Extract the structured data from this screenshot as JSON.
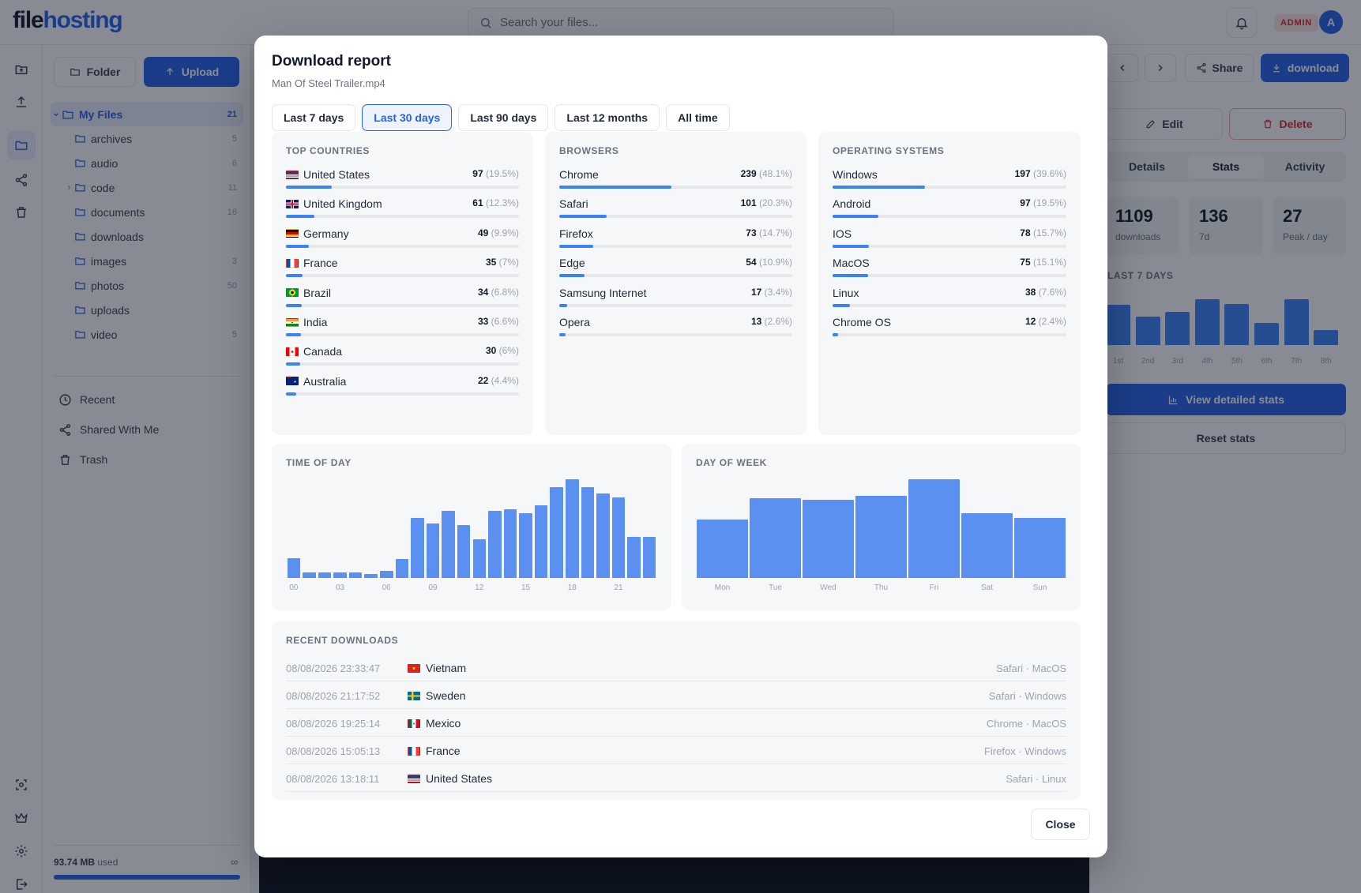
{
  "app": {
    "logo_part1": "file",
    "logo_part2": "hosting",
    "search_placeholder": "Search your files...",
    "admin_badge": "ADMIN",
    "avatar_initial": "A",
    "accent_color": "#2563eb"
  },
  "sidebar": {
    "folder_button": "Folder",
    "upload_button": "Upload",
    "root": {
      "label": "My Files",
      "count": "21"
    },
    "folders": [
      {
        "label": "archives",
        "count": "5",
        "expandable": false
      },
      {
        "label": "audio",
        "count": "6",
        "expandable": false
      },
      {
        "label": "code",
        "count": "11",
        "expandable": true
      },
      {
        "label": "documents",
        "count": "16",
        "expandable": false
      },
      {
        "label": "downloads",
        "count": "",
        "expandable": false
      },
      {
        "label": "images",
        "count": "3",
        "expandable": false
      },
      {
        "label": "photos",
        "count": "50",
        "expandable": false
      },
      {
        "label": "uploads",
        "count": "",
        "expandable": false
      },
      {
        "label": "video",
        "count": "5",
        "expandable": false
      }
    ],
    "links": [
      {
        "label": "Recent",
        "icon": "clock-icon"
      },
      {
        "label": "Shared With Me",
        "icon": "share-icon"
      },
      {
        "label": "Trash",
        "icon": "trash-icon"
      }
    ],
    "storage_used": "93.74 MB",
    "storage_suffix": "used",
    "storage_limit": "∞",
    "storage_fraction": 1.0
  },
  "right_panel": {
    "share": "Share",
    "download": "download",
    "edit": "Edit",
    "delete": "Delete",
    "tabs": [
      "Details",
      "Stats",
      "Activity"
    ],
    "active_tab": "Stats",
    "stats": [
      {
        "value": "1109",
        "label": "downloads"
      },
      {
        "value": "136",
        "label": "7d"
      },
      {
        "value": "27",
        "label": "Peak / day"
      }
    ],
    "last7_title": "LAST 7 DAYS",
    "last7": [
      {
        "label": "1st",
        "value": 68
      },
      {
        "label": "2nd",
        "value": 48
      },
      {
        "label": "3rd",
        "value": 56
      },
      {
        "label": "4th",
        "value": 78
      },
      {
        "label": "5th",
        "value": 70
      },
      {
        "label": "6th",
        "value": 38
      },
      {
        "label": "7th",
        "value": 78
      },
      {
        "label": "8th",
        "value": 26
      }
    ],
    "view_detailed": "View detailed stats",
    "reset": "Reset stats"
  },
  "modal": {
    "title": "Download report",
    "subtitle": "Man Of Steel Trailer.mp4",
    "ranges": [
      "Last 7 days",
      "Last 30 days",
      "Last 90 days",
      "Last 12 months",
      "All time"
    ],
    "active_range": "Last 30 days",
    "countries_title": "TOP COUNTRIES",
    "countries": [
      {
        "name": "United States",
        "value": "97",
        "pct": "(19.5%)",
        "frac": 0.195,
        "flag": "us"
      },
      {
        "name": "United Kingdom",
        "value": "61",
        "pct": "(12.3%)",
        "frac": 0.123,
        "flag": "gb"
      },
      {
        "name": "Germany",
        "value": "49",
        "pct": "(9.9%)",
        "frac": 0.099,
        "flag": "de"
      },
      {
        "name": "France",
        "value": "35",
        "pct": "(7%)",
        "frac": 0.07,
        "flag": "fr"
      },
      {
        "name": "Brazil",
        "value": "34",
        "pct": "(6.8%)",
        "frac": 0.068,
        "flag": "br"
      },
      {
        "name": "India",
        "value": "33",
        "pct": "(6.6%)",
        "frac": 0.066,
        "flag": "in"
      },
      {
        "name": "Canada",
        "value": "30",
        "pct": "(6%)",
        "frac": 0.06,
        "flag": "ca"
      },
      {
        "name": "Australia",
        "value": "22",
        "pct": "(4.4%)",
        "frac": 0.044,
        "flag": "au"
      }
    ],
    "browsers_title": "BROWSERS",
    "browsers": [
      {
        "name": "Chrome",
        "value": "239",
        "pct": "(48.1%)",
        "frac": 0.481
      },
      {
        "name": "Safari",
        "value": "101",
        "pct": "(20.3%)",
        "frac": 0.203
      },
      {
        "name": "Firefox",
        "value": "73",
        "pct": "(14.7%)",
        "frac": 0.147
      },
      {
        "name": "Edge",
        "value": "54",
        "pct": "(10.9%)",
        "frac": 0.109
      },
      {
        "name": "Samsung Internet",
        "value": "17",
        "pct": "(3.4%)",
        "frac": 0.034
      },
      {
        "name": "Opera",
        "value": "13",
        "pct": "(2.6%)",
        "frac": 0.026
      }
    ],
    "os_title": "OPERATING SYSTEMS",
    "os": [
      {
        "name": "Windows",
        "value": "197",
        "pct": "(39.6%)",
        "frac": 0.396
      },
      {
        "name": "Android",
        "value": "97",
        "pct": "(19.5%)",
        "frac": 0.195
      },
      {
        "name": "IOS",
        "value": "78",
        "pct": "(15.7%)",
        "frac": 0.157
      },
      {
        "name": "MacOS",
        "value": "75",
        "pct": "(15.1%)",
        "frac": 0.151
      },
      {
        "name": "Linux",
        "value": "38",
        "pct": "(7.6%)",
        "frac": 0.076
      },
      {
        "name": "Chrome OS",
        "value": "12",
        "pct": "(2.4%)",
        "frac": 0.024
      }
    ],
    "recent_title": "RECENT DOWNLOADS",
    "recent": [
      {
        "time": "08/08/2026 23:33:47",
        "country": "Vietnam",
        "flag": "vn",
        "ua": "Safari · MacOS"
      },
      {
        "time": "08/08/2026 21:17:52",
        "country": "Sweden",
        "flag": "se",
        "ua": "Safari · Windows"
      },
      {
        "time": "08/08/2026 19:25:14",
        "country": "Mexico",
        "flag": "mx",
        "ua": "Chrome · MacOS"
      },
      {
        "time": "08/08/2026 15:05:13",
        "country": "France",
        "flag": "fr",
        "ua": "Firefox · Windows"
      },
      {
        "time": "08/08/2026 13:18:11",
        "country": "United States",
        "flag": "us",
        "ua": "Safari · Linux"
      }
    ],
    "close": "Close"
  },
  "chart_data": [
    {
      "type": "bar",
      "title": "TIME OF DAY",
      "categories": [
        "00",
        "01",
        "02",
        "03",
        "04",
        "05",
        "06",
        "07",
        "08",
        "09",
        "10",
        "11",
        "12",
        "13",
        "14",
        "15",
        "16",
        "17",
        "18",
        "19",
        "20",
        "21",
        "22",
        "23"
      ],
      "tick_labels": [
        "00",
        "03",
        "06",
        "09",
        "12",
        "15",
        "18",
        "21"
      ],
      "values": [
        20,
        6,
        6,
        6,
        6,
        4,
        7,
        19,
        61,
        55,
        68,
        54,
        39,
        68,
        70,
        66,
        74,
        92,
        100,
        92,
        86,
        82,
        42,
        42
      ],
      "ylim": [
        0,
        100
      ],
      "grid": false
    },
    {
      "type": "bar",
      "title": "DAY OF WEEK",
      "categories": [
        "Mon",
        "Tue",
        "Wed",
        "Thu",
        "Fri",
        "Sat",
        "Sun"
      ],
      "values": [
        59,
        81,
        79,
        83,
        100,
        66,
        61
      ],
      "ylim": [
        0,
        100
      ],
      "grid": false
    }
  ]
}
